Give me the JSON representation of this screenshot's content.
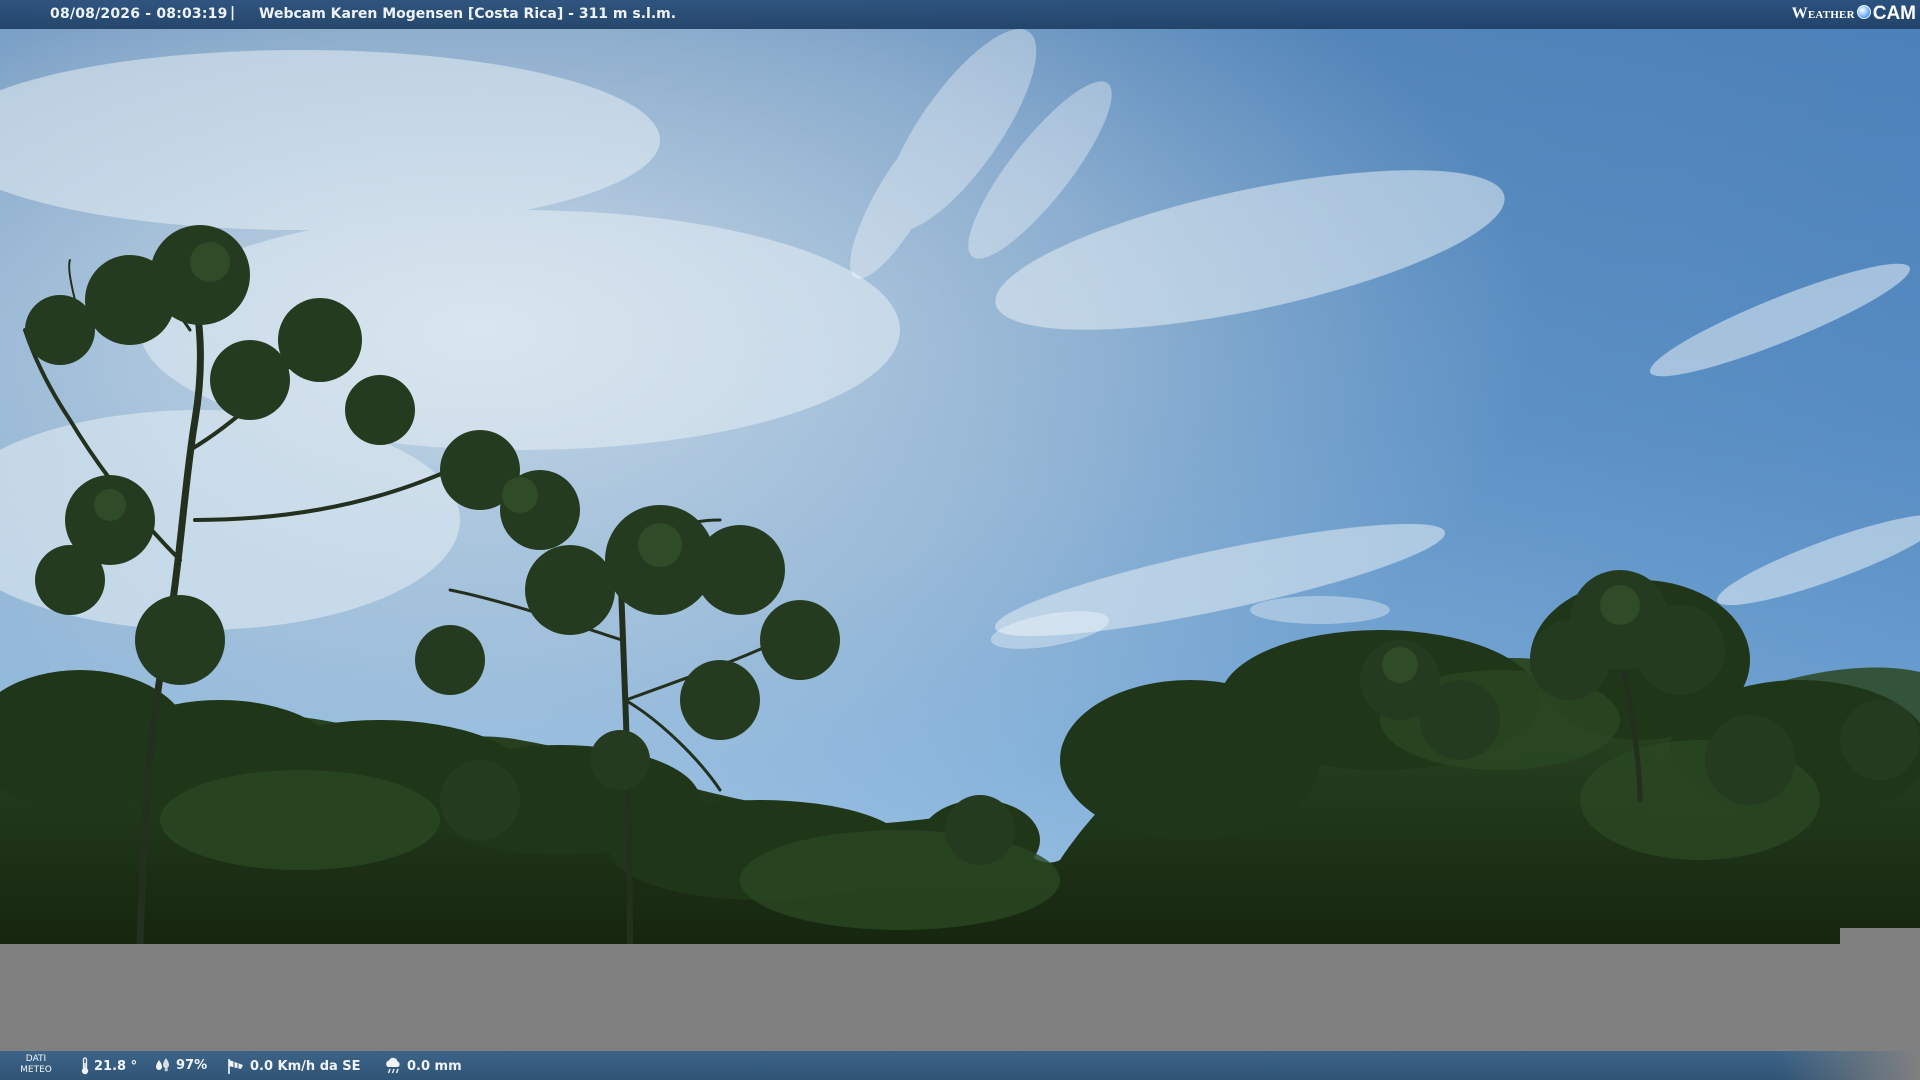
{
  "header": {
    "timestamp": "08/08/2026 - 08:03:19",
    "separator": "|",
    "title": "Webcam Karen Mogensen [Costa Rica]  - 311 m s.l.m."
  },
  "logo": {
    "weather": "Weather",
    "cam": "CAM"
  },
  "meteo": {
    "label_line1": "DATI",
    "label_line2": "METEO",
    "temperature": "21.8 °",
    "humidity": "97%",
    "wind": "0.0 Km/h da SE",
    "rain": "0.0 mm"
  },
  "icons": {
    "temperature": "thermometer-icon",
    "humidity": "humidity-drops-icon",
    "wind": "wind-sock-icon",
    "rain": "rain-cloud-icon"
  },
  "colors": {
    "sky_top": "#4c83b8",
    "sky_horizon": "#9cc2e4",
    "foliage": "#1d3318",
    "bar": "#2f5476",
    "mask": "#808080"
  }
}
